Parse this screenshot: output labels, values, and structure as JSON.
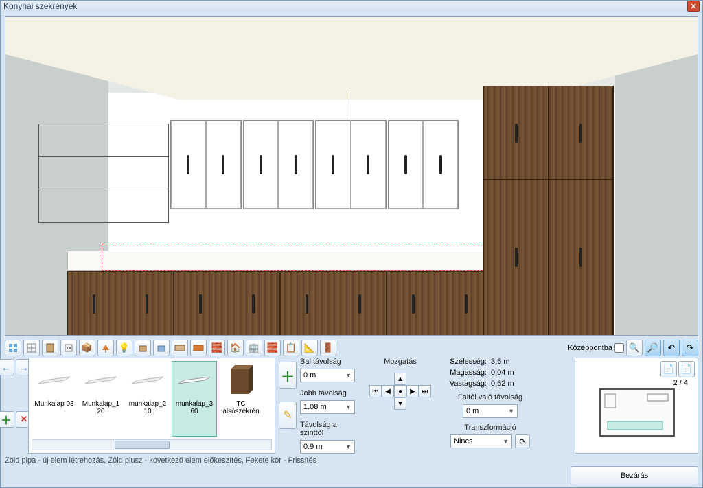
{
  "window": {
    "title": "Konyhai szekrények"
  },
  "toolbar": {
    "center_label": "Középpontba"
  },
  "gallery": {
    "items": [
      {
        "label": "Munkalap 03"
      },
      {
        "label": "Munkalap_120"
      },
      {
        "label": "munkalap_210"
      },
      {
        "label": "munkalap_360"
      },
      {
        "label": "TC alsószekrén"
      }
    ],
    "selected_index": 3
  },
  "props": {
    "bal_tavolsag_label": "Bal távolság",
    "bal_tavolsag_value": "0 m",
    "jobb_tavolsag_label": "Jobb távolság",
    "jobb_tavolsag_value": "1.08 m",
    "tav_szinttol_label": "Távolság a szinttől",
    "tav_szinttol_value": "0.9 m",
    "mozgatas_label": "Mozgatás",
    "szelesseg_label": "Szélesség:",
    "szelesseg_value": "3.6 m",
    "magassag_label": "Magasság:",
    "magassag_value": "0.04 m",
    "vastagsag_label": "Vastagság:",
    "vastagsag_value": "0.62 m",
    "faltol_label": "Faltól való távolság",
    "faltol_value": "0 m",
    "transzf_label": "Transzformáció",
    "transzf_value": "Nincs",
    "pager": "2 / 4"
  },
  "status": {
    "text": "Zöld pipa - új elem létrehozás, Zöld plusz - következő elem előkészítés, Fekete kör - Frissítés"
  },
  "footer": {
    "close_label": "Bezárás"
  }
}
